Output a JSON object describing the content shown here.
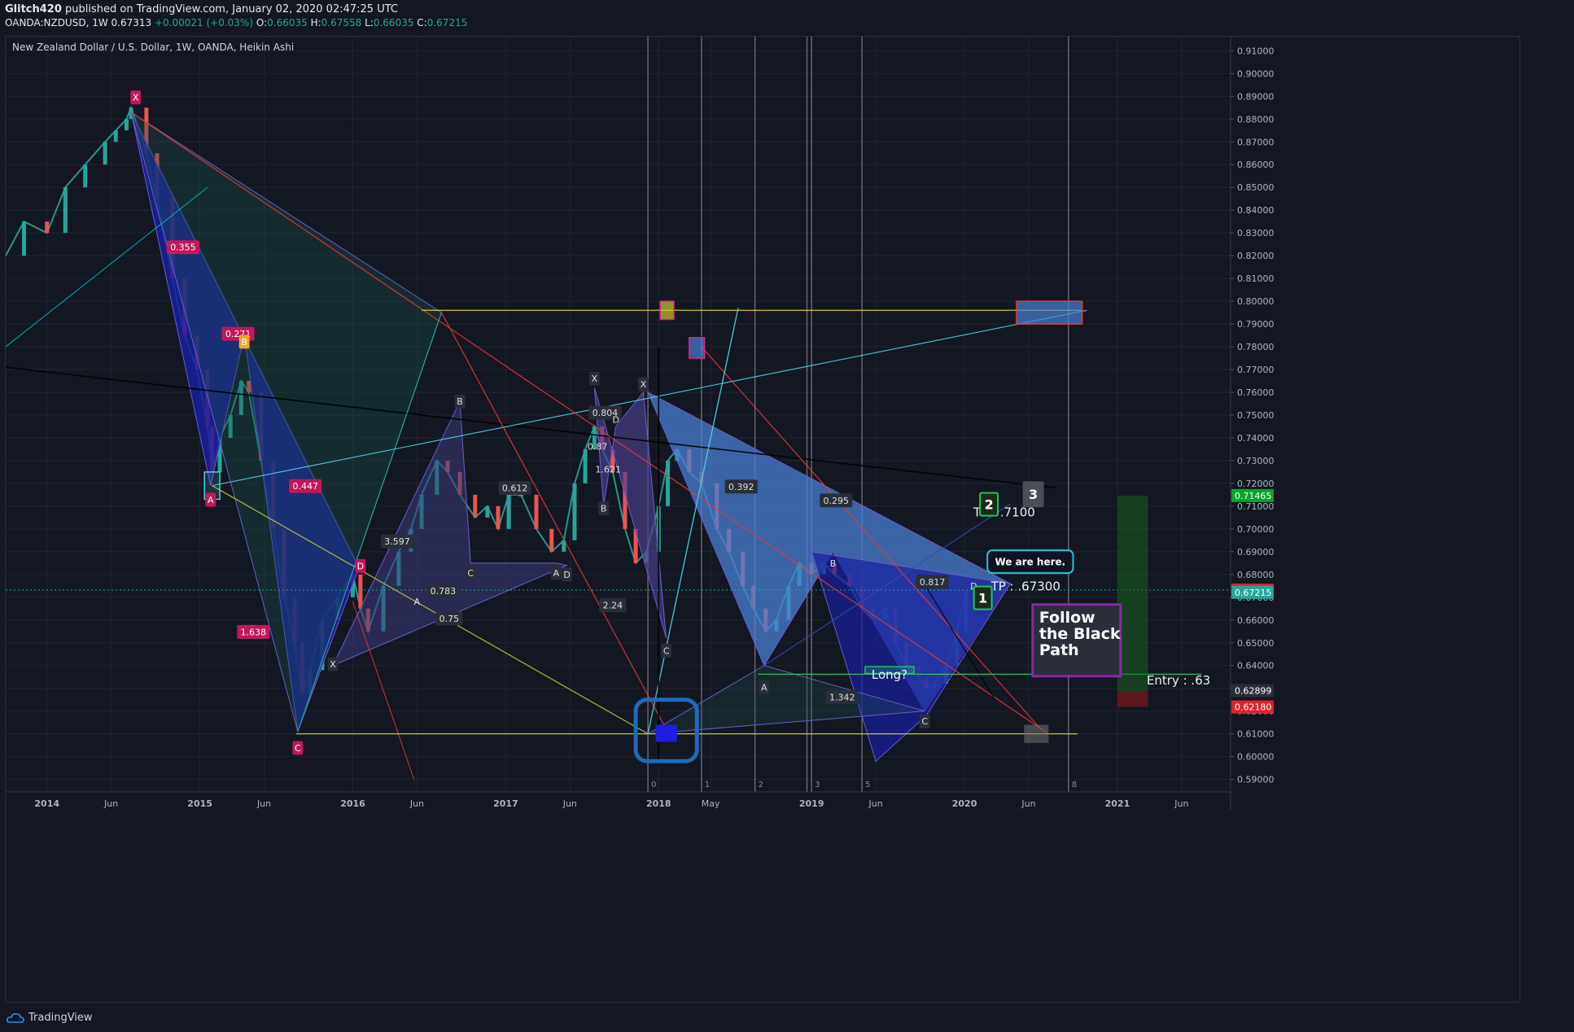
{
  "header": {
    "author": "Glitch420",
    "published_text": " published on TradingView.com, January 02, 2020 02:47:25 UTC",
    "symbol": "OANDA:NZDUSD, 1W",
    "last": "0.67313",
    "change": "+0.00021 (+0.03%)",
    "o_label": "O:",
    "o": "0.66035",
    "h_label": "H:",
    "h": "0.67558",
    "l_label": "L:",
    "l": "0.66035",
    "c_label": "C:",
    "c": "0.67215"
  },
  "chart_title": "New Zealand Dollar / U.S. Dollar, 1W, OANDA, Heikin Ashi",
  "footer": {
    "brand": "TradingView"
  },
  "colors": {
    "background": "#131722",
    "grid": "#1f2433",
    "up": "#26a69a",
    "down": "#ef5350",
    "pattern_blue": "#1a1f9e",
    "pattern_light": "#4a7fd4",
    "accent_magenta": "#e91e8c"
  },
  "chart_data": {
    "type": "candlestick",
    "title": "New Zealand Dollar / U.S. Dollar, 1W, OANDA, Heikin Ashi",
    "x_ticks": [
      "2014",
      "Jun",
      "2015",
      "Jun",
      "2016",
      "Jun",
      "2017",
      "Jun",
      "2018",
      "May",
      "2019",
      "Jun",
      "2020",
      "Jun",
      "2021",
      "Jun"
    ],
    "x_tick_years": [
      2014.0,
      2014.42,
      2015.0,
      2015.42,
      2016.0,
      2016.42,
      2017.0,
      2017.42,
      2018.0,
      2018.34,
      2019.0,
      2019.42,
      2020.0,
      2020.42,
      2021.0,
      2021.42
    ],
    "xlim": [
      2013.73,
      2021.74
    ],
    "ylim": [
      0.5845,
      0.9162
    ],
    "y_ticks": [
      "0.91000",
      "0.90000",
      "0.89000",
      "0.88000",
      "0.87000",
      "0.86000",
      "0.85000",
      "0.84000",
      "0.83000",
      "0.82000",
      "0.81000",
      "0.80000",
      "0.79000",
      "0.78000",
      "0.77000",
      "0.76000",
      "0.75000",
      "0.74000",
      "0.73000",
      "0.72000",
      "0.71000",
      "0.70000",
      "0.69000",
      "0.68000",
      "0.67000",
      "0.66000",
      "0.65000",
      "0.64000",
      "0.63000",
      "0.62000",
      "0.61000",
      "0.60000",
      "0.59000"
    ],
    "price_series": [
      [
        2013.73,
        0.82
      ],
      [
        2013.85,
        0.835
      ],
      [
        2014.0,
        0.83
      ],
      [
        2014.12,
        0.85
      ],
      [
        2014.25,
        0.86
      ],
      [
        2014.38,
        0.87
      ],
      [
        2014.45,
        0.875
      ],
      [
        2014.52,
        0.88
      ],
      [
        2014.55,
        0.885
      ],
      [
        2014.65,
        0.865
      ],
      [
        2014.72,
        0.845
      ],
      [
        2014.82,
        0.81
      ],
      [
        2014.9,
        0.785
      ],
      [
        2014.98,
        0.77
      ],
      [
        2015.05,
        0.745
      ],
      [
        2015.08,
        0.725
      ],
      [
        2015.13,
        0.74
      ],
      [
        2015.2,
        0.75
      ],
      [
        2015.27,
        0.765
      ],
      [
        2015.32,
        0.76
      ],
      [
        2015.4,
        0.73
      ],
      [
        2015.48,
        0.7
      ],
      [
        2015.55,
        0.67
      ],
      [
        2015.62,
        0.65
      ],
      [
        2015.67,
        0.628
      ],
      [
        2015.72,
        0.638
      ],
      [
        2015.8,
        0.66
      ],
      [
        2015.9,
        0.67
      ],
      [
        2016.0,
        0.68
      ],
      [
        2016.05,
        0.665
      ],
      [
        2016.1,
        0.655
      ],
      [
        2016.2,
        0.675
      ],
      [
        2016.3,
        0.69
      ],
      [
        2016.38,
        0.7
      ],
      [
        2016.45,
        0.715
      ],
      [
        2016.55,
        0.73
      ],
      [
        2016.62,
        0.725
      ],
      [
        2016.7,
        0.715
      ],
      [
        2016.8,
        0.705
      ],
      [
        2016.88,
        0.71
      ],
      [
        2016.95,
        0.7
      ],
      [
        2017.02,
        0.715
      ],
      [
        2017.1,
        0.715
      ],
      [
        2017.2,
        0.7
      ],
      [
        2017.3,
        0.69
      ],
      [
        2017.38,
        0.695
      ],
      [
        2017.45,
        0.72
      ],
      [
        2017.52,
        0.735
      ],
      [
        2017.58,
        0.745
      ],
      [
        2017.63,
        0.735
      ],
      [
        2017.7,
        0.725
      ],
      [
        2017.78,
        0.7
      ],
      [
        2017.85,
        0.685
      ],
      [
        2017.92,
        0.69
      ],
      [
        2018.0,
        0.71
      ],
      [
        2018.06,
        0.73
      ],
      [
        2018.12,
        0.735
      ],
      [
        2018.2,
        0.725
      ],
      [
        2018.28,
        0.72
      ],
      [
        2018.38,
        0.7
      ],
      [
        2018.46,
        0.69
      ],
      [
        2018.55,
        0.675
      ],
      [
        2018.62,
        0.665
      ],
      [
        2018.7,
        0.655
      ],
      [
        2018.77,
        0.66
      ],
      [
        2018.85,
        0.675
      ],
      [
        2018.92,
        0.685
      ],
      [
        2019.0,
        0.68
      ],
      [
        2019.08,
        0.685
      ],
      [
        2019.15,
        0.68
      ],
      [
        2019.25,
        0.675
      ],
      [
        2019.33,
        0.665
      ],
      [
        2019.4,
        0.66
      ],
      [
        2019.48,
        0.665
      ],
      [
        2019.55,
        0.65
      ],
      [
        2019.62,
        0.64
      ],
      [
        2019.7,
        0.635
      ],
      [
        2019.75,
        0.63
      ],
      [
        2019.8,
        0.632
      ],
      [
        2019.88,
        0.64
      ],
      [
        2019.95,
        0.655
      ],
      [
        2020.01,
        0.673
      ]
    ],
    "current_price": 0.67313,
    "price_labels": [
      {
        "text": "0.71465",
        "value": 0.71465,
        "color": "#00a828"
      },
      {
        "text": "0.67313",
        "value": 0.67313,
        "color": "#e0222b"
      },
      {
        "text": "0.67215",
        "value": 0.67215,
        "color": "#26a69a"
      },
      {
        "text": "0.62899",
        "value": 0.62899,
        "color": "#2a2e39"
      },
      {
        "text": "0.62180",
        "value": 0.6218,
        "color": "#e0222b"
      }
    ],
    "annotations": [
      {
        "text": "X",
        "x": 2014.58,
        "y": 0.8895,
        "style": "pink"
      },
      {
        "text": "0.355",
        "x": 2014.89,
        "y": 0.8237,
        "style": "pink"
      },
      {
        "text": "0.271",
        "x": 2015.25,
        "y": 0.7857,
        "style": "pink"
      },
      {
        "text": "B",
        "x": 2015.29,
        "y": 0.7822,
        "style": "orange"
      },
      {
        "text": "A",
        "x": 2015.07,
        "y": 0.7128,
        "style": "pink"
      },
      {
        "text": "0.447",
        "x": 2015.69,
        "y": 0.7188,
        "style": "pink"
      },
      {
        "text": "D",
        "x": 2016.05,
        "y": 0.6837,
        "style": "pink"
      },
      {
        "text": "1.638",
        "x": 2015.35,
        "y": 0.6548,
        "style": "pink"
      },
      {
        "text": "C",
        "x": 2015.64,
        "y": 0.6038,
        "style": "pink"
      },
      {
        "text": "X",
        "x": 2015.87,
        "y": 0.6406,
        "style": "gray"
      },
      {
        "text": "3.597",
        "x": 2016.29,
        "y": 0.6945,
        "style": "gray"
      },
      {
        "text": "A",
        "x": 2016.42,
        "y": 0.6682,
        "style": "plain"
      },
      {
        "text": "0.783",
        "x": 2016.59,
        "y": 0.6727,
        "style": "gray"
      },
      {
        "text": "0.75",
        "x": 2016.63,
        "y": 0.6607,
        "style": "gray"
      },
      {
        "text": "B",
        "x": 2016.7,
        "y": 0.756,
        "style": "gray"
      },
      {
        "text": "C",
        "x": 2016.77,
        "y": 0.6807,
        "style": "gray"
      },
      {
        "text": "0.612",
        "x": 2017.06,
        "y": 0.718,
        "style": "gray"
      },
      {
        "text": "A",
        "x": 2017.33,
        "y": 0.6807,
        "style": "gray"
      },
      {
        "text": "D",
        "x": 2017.4,
        "y": 0.68,
        "style": "gray"
      },
      {
        "text": "X",
        "x": 2017.58,
        "y": 0.766,
        "style": "gray"
      },
      {
        "text": "0.804",
        "x": 2017.65,
        "y": 0.751,
        "style": "gray"
      },
      {
        "text": "D",
        "x": 2017.72,
        "y": 0.7481,
        "style": "plain"
      },
      {
        "text": "0.87",
        "x": 2017.6,
        "y": 0.7362,
        "style": "plain"
      },
      {
        "text": "1.621",
        "x": 2017.67,
        "y": 0.7262,
        "style": "plain"
      },
      {
        "text": "B",
        "x": 2017.64,
        "y": 0.709,
        "style": "gray"
      },
      {
        "text": "2.24",
        "x": 2017.7,
        "y": 0.6665,
        "style": "gray"
      },
      {
        "text": "X",
        "x": 2017.9,
        "y": 0.7635,
        "style": "gray"
      },
      {
        "text": "C",
        "x": 2018.05,
        "y": 0.6465,
        "style": "gray"
      },
      {
        "text": "0.392",
        "x": 2018.54,
        "y": 0.7186,
        "style": "gray"
      },
      {
        "text": "0.295",
        "x": 2019.16,
        "y": 0.7125,
        "style": "gray"
      },
      {
        "text": "B",
        "x": 2019.14,
        "y": 0.685,
        "style": "plain"
      },
      {
        "text": "A",
        "x": 2018.69,
        "y": 0.6305,
        "style": "gray"
      },
      {
        "text": "1.342",
        "x": 2019.2,
        "y": 0.6262,
        "style": "gray"
      },
      {
        "text": "0.817",
        "x": 2019.79,
        "y": 0.6767,
        "style": "gray"
      },
      {
        "text": "C",
        "x": 2019.74,
        "y": 0.6155,
        "style": "gray"
      },
      {
        "text": "D",
        "x": 2020.06,
        "y": 0.6749,
        "style": "plain"
      },
      {
        "text": "Long?",
        "x": 2019.51,
        "y": 0.6362,
        "style": "plain-lg"
      },
      {
        "text": "TP : .7100",
        "x": 2020.26,
        "y": 0.7075,
        "style": "plain-lg"
      },
      {
        "text": "TP : .67300",
        "x": 2020.4,
        "y": 0.6749,
        "style": "plain-lg"
      },
      {
        "text": "Entry : .63",
        "x": 2021.4,
        "y": 0.6336,
        "style": "plain-lg"
      },
      {
        "text": "We are here.",
        "x": 2020.43,
        "y": 0.6856,
        "style": "callout"
      },
      {
        "text": "Follow the Black Path",
        "x": 2020.68,
        "y": 0.6525,
        "style": "follow"
      },
      {
        "text": "1",
        "x": 2020.12,
        "y": 0.6697,
        "style": "num-green"
      },
      {
        "text": "2",
        "x": 2020.16,
        "y": 0.7108,
        "style": "num-green"
      },
      {
        "text": "3",
        "x": 2020.45,
        "y": 0.7152,
        "style": "num-gray"
      }
    ],
    "vertical_marks": [
      {
        "x": 2017.93,
        "label": "0"
      },
      {
        "x": 2018.28,
        "label": "1"
      },
      {
        "x": 2018.63,
        "label": "2"
      },
      {
        "x": 2018.97,
        "label": ""
      },
      {
        "x": 2019.33,
        "label": "5"
      },
      {
        "x": 2019.0,
        "label": "3"
      },
      {
        "x": 2020.68,
        "label": "8"
      }
    ],
    "horizontal_levels": [
      {
        "y": 0.796,
        "from": 2016.45,
        "to": 2020.77,
        "color": "#c8c832"
      },
      {
        "y": 0.61,
        "from": 2015.63,
        "to": 2020.74,
        "color": "#c8c832"
      },
      {
        "y": 0.6362,
        "from": 2018.65,
        "to": 2021.55,
        "color": "#22c55e"
      }
    ]
  }
}
